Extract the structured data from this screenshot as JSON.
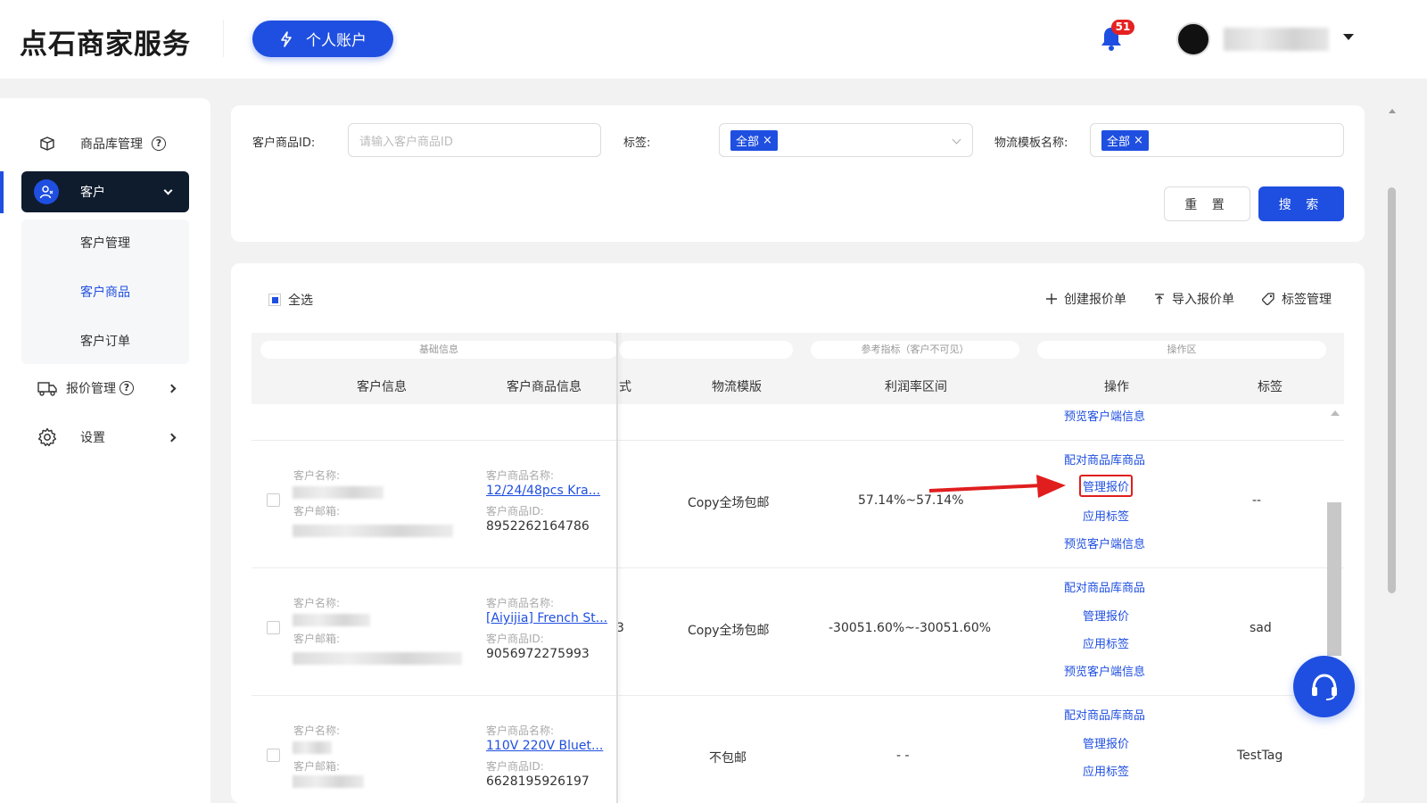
{
  "header": {
    "logo": "点石商家服务",
    "account_button": "个人账户",
    "notification_count": "51"
  },
  "sidebar": {
    "items": [
      {
        "label": "商品库管理",
        "icon": "box-icon"
      },
      {
        "label": "客户",
        "icon": "user-icon"
      },
      {
        "label": "报价管理",
        "icon": "truck-icon"
      },
      {
        "label": "设置",
        "icon": "gear-icon"
      }
    ],
    "sub_items": [
      "客户管理",
      "客户商品",
      "客户订单"
    ]
  },
  "filters": {
    "product_id_label": "客户商品ID:",
    "product_id_placeholder": "请输入客户商品ID",
    "tag_label": "标签:",
    "tag_value": "全部",
    "logistics_label": "物流模板名称:",
    "logistics_value": "全部",
    "reset_button": "重 置",
    "search_button": "搜 索"
  },
  "table": {
    "select_all": "全选",
    "actions": {
      "create": "创建报价单",
      "import": "导入报价单",
      "tags": "标签管理"
    },
    "groups": {
      "basic": "基础信息",
      "reference": "参考指标（客户不可见）",
      "operations": "操作区"
    },
    "headers": {
      "customer_info": "客户信息",
      "product_info": "客户商品信息",
      "mode_fragment": "式",
      "logistics": "物流模版",
      "profit": "利润率区间",
      "operation": "操作",
      "tag": "标签"
    },
    "labels": {
      "customer_name": "客户名称:",
      "customer_email": "客户邮箱:",
      "product_name": "客户商品名称:",
      "product_id": "客户商品ID:"
    },
    "ops": {
      "match": "配对商品库商品",
      "manage_quote": "管理报价",
      "apply_tag": "应用标签",
      "preview": "预览客户端信息"
    },
    "rows": [
      {
        "product_name": "12/24/48pcs Kra...",
        "product_id": "8952262164786",
        "mode_fragment": "",
        "logistics": "Copy全场包邮",
        "profit": "57.14%~57.14%",
        "tag": "--"
      },
      {
        "product_name": "[Aiyijia] French St...",
        "product_id": "9056972275993",
        "mode_fragment": "3",
        "logistics": "Copy全场包邮",
        "profit": "-30051.60%~-30051.60%",
        "tag": "sad"
      },
      {
        "product_name": "110V 220V Bluet...",
        "product_id": "6628195926197",
        "mode_fragment": "",
        "logistics": "不包邮",
        "profit": "- -",
        "tag": "TestTag"
      }
    ]
  },
  "colors": {
    "primary": "#1f4fe0",
    "sidebar_active": "#0f1c2e",
    "badge": "#e52121",
    "annotation": "#e01e1e"
  }
}
